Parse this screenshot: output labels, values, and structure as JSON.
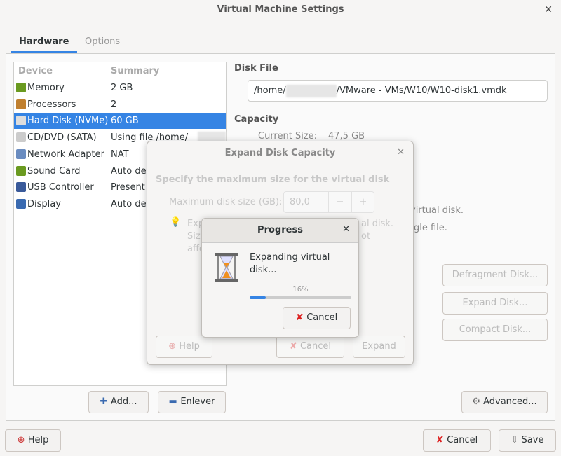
{
  "window": {
    "title": "Virtual Machine Settings"
  },
  "tabs": [
    {
      "label": "Hardware"
    },
    {
      "label": "Options"
    }
  ],
  "device_list": {
    "headers": {
      "device": "Device",
      "summary": "Summary"
    },
    "items": [
      {
        "device": "Memory",
        "summary": "2 GB",
        "icon": "memory-icon",
        "color": "#6a9a20"
      },
      {
        "device": "Processors",
        "summary": "2",
        "icon": "cpu-icon",
        "color": "#c08030"
      },
      {
        "device": "Hard Disk (NVMe)",
        "summary": "60 GB",
        "icon": "hard-disk-icon",
        "color": "#dddddd"
      },
      {
        "device": "CD/DVD (SATA)",
        "summary": "Using file /home/",
        "icon": "cd-icon",
        "color": "#cccccc"
      },
      {
        "device": "Network Adapter",
        "summary": "NAT",
        "icon": "network-icon",
        "color": "#6a8cc0"
      },
      {
        "device": "Sound Card",
        "summary": "Auto det",
        "icon": "sound-card-icon",
        "color": "#6a9a20"
      },
      {
        "device": "USB Controller",
        "summary": "Present",
        "icon": "usb-icon",
        "color": "#3a5a9a"
      },
      {
        "device": "Display",
        "summary": "Auto det",
        "icon": "display-icon",
        "color": "#3a6ab0"
      }
    ]
  },
  "buttons": {
    "add": "Add...",
    "remove": "Enlever",
    "help": "Help",
    "cancel": "Cancel",
    "save": "Save",
    "defragment": "Defragment Disk...",
    "expand": "Expand Disk...",
    "compact": "Compact Disk...",
    "advanced": "Advanced..."
  },
  "disk": {
    "file_label": "Disk File",
    "path_prefix": "/home/",
    "path_suffix": "/VMware - VMs/W10/W10-disk1.vmdk",
    "capacity_label": "Capacity",
    "current_size_label": "Current Size:",
    "current_size": "47,5 GB",
    "info1": "virtual disk.",
    "info2": "gle file."
  },
  "expand_dialog": {
    "title": "Expand Disk Capacity",
    "heading": "Specify the maximum size for the virtual disk",
    "size_label": "Maximum disk size (GB):",
    "size_value": "80,0",
    "minus": "−",
    "plus": "+",
    "tip1a": "Exp",
    "tip1b": "al disk.",
    "tip2a": "Siz",
    "tip2b": "ot",
    "tip3a": "affe",
    "help": "Help",
    "cancel": "Cancel",
    "expand": "Expand"
  },
  "progress_dialog": {
    "title": "Progress",
    "message": "Expanding virtual disk...",
    "percent_label": "16%",
    "progress": 0.16,
    "cancel": "Cancel",
    "accent": "#3584e4"
  }
}
